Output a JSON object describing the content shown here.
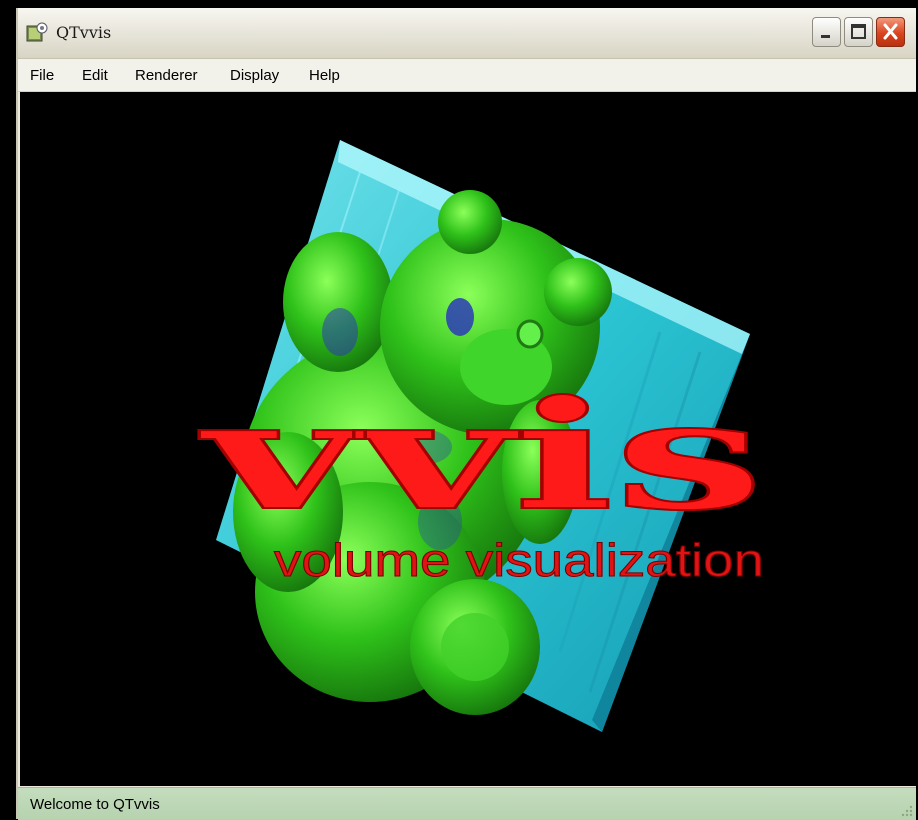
{
  "window": {
    "title": "QTvvis"
  },
  "menu": {
    "items": [
      "File",
      "Edit",
      "Renderer",
      "Display",
      "Help"
    ]
  },
  "splash": {
    "logo": "vvis",
    "tagline": "volume visualization"
  },
  "status": {
    "text": "Welcome to QTvvis"
  },
  "colors": {
    "logo_red": "#ff1a1a",
    "volume_cyan": "#33e6f0",
    "bear_green": "#2fc21a",
    "status_bg": "#b9d5b0"
  }
}
